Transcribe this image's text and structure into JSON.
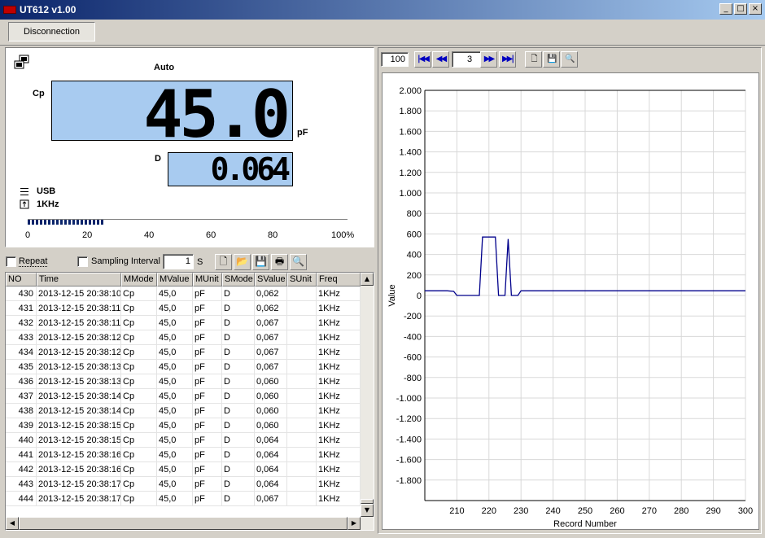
{
  "window": {
    "title": "UT612 v1.00",
    "btn_min": "_",
    "btn_max": "□",
    "btn_close": "×"
  },
  "toolbar": {
    "disconnect_label": "Disconnection"
  },
  "meter": {
    "mode": "Auto",
    "primary_label": "Cp",
    "primary_value": "45.0",
    "primary_unit": "pF",
    "secondary_label": "D",
    "secondary_value": "0.064",
    "interface": "USB",
    "frequency": "1KHz",
    "progress_percent": 24,
    "scale": [
      "0",
      "20",
      "40",
      "60",
      "80",
      "100%"
    ]
  },
  "table_toolbar": {
    "repeat_label": "Repeat",
    "sampling_label": "Sampling Interval",
    "sampling_value": "1",
    "sampling_unit": "S"
  },
  "table": {
    "columns": [
      "NO",
      "Time",
      "MMode",
      "MValue",
      "MUnit",
      "SMode",
      "SValue",
      "SUnit",
      "Freq"
    ],
    "rows": [
      [
        "430",
        "2013-12-15 20:38:10",
        "Cp",
        "45,0",
        "pF",
        "D",
        "0,062",
        "",
        "1KHz"
      ],
      [
        "431",
        "2013-12-15 20:38:11",
        "Cp",
        "45,0",
        "pF",
        "D",
        "0,062",
        "",
        "1KHz"
      ],
      [
        "432",
        "2013-12-15 20:38:11",
        "Cp",
        "45,0",
        "pF",
        "D",
        "0,067",
        "",
        "1KHz"
      ],
      [
        "433",
        "2013-12-15 20:38:12",
        "Cp",
        "45,0",
        "pF",
        "D",
        "0,067",
        "",
        "1KHz"
      ],
      [
        "434",
        "2013-12-15 20:38:12",
        "Cp",
        "45,0",
        "pF",
        "D",
        "0,067",
        "",
        "1KHz"
      ],
      [
        "435",
        "2013-12-15 20:38:13",
        "Cp",
        "45,0",
        "pF",
        "D",
        "0,067",
        "",
        "1KHz"
      ],
      [
        "436",
        "2013-12-15 20:38:13",
        "Cp",
        "45,0",
        "pF",
        "D",
        "0,060",
        "",
        "1KHz"
      ],
      [
        "437",
        "2013-12-15 20:38:14",
        "Cp",
        "45,0",
        "pF",
        "D",
        "0,060",
        "",
        "1KHz"
      ],
      [
        "438",
        "2013-12-15 20:38:14",
        "Cp",
        "45,0",
        "pF",
        "D",
        "0,060",
        "",
        "1KHz"
      ],
      [
        "439",
        "2013-12-15 20:38:15",
        "Cp",
        "45,0",
        "pF",
        "D",
        "0,060",
        "",
        "1KHz"
      ],
      [
        "440",
        "2013-12-15 20:38:15",
        "Cp",
        "45,0",
        "pF",
        "D",
        "0,064",
        "",
        "1KHz"
      ],
      [
        "441",
        "2013-12-15 20:38:16",
        "Cp",
        "45,0",
        "pF",
        "D",
        "0,064",
        "",
        "1KHz"
      ],
      [
        "442",
        "2013-12-15 20:38:16",
        "Cp",
        "45,0",
        "pF",
        "D",
        "0,064",
        "",
        "1KHz"
      ],
      [
        "443",
        "2013-12-15 20:38:17",
        "Cp",
        "45,0",
        "pF",
        "D",
        "0,064",
        "",
        "1KHz"
      ],
      [
        "444",
        "2013-12-15 20:38:17",
        "Cp",
        "45,0",
        "pF",
        "D",
        "0,067",
        "",
        "1KHz"
      ]
    ]
  },
  "chart_nav": {
    "zoom_value": "100",
    "page_value": "3"
  },
  "chart_data": {
    "type": "line",
    "xlabel": "Record Number",
    "ylabel": "Value",
    "xlim": [
      200,
      300
    ],
    "ylim": [
      -2000,
      2000
    ],
    "x_ticks": [
      210,
      220,
      230,
      240,
      250,
      260,
      270,
      280,
      290,
      300
    ],
    "y_ticks": [
      "2.000",
      "1.800",
      "1.600",
      "1.400",
      "1.200",
      "1.000",
      "800",
      "600",
      "400",
      "200",
      "0",
      "-200",
      "-400",
      "-600",
      "-800",
      "-1.000",
      "-1.200",
      "-1.400",
      "-1.600",
      "-1.800"
    ],
    "grid": true,
    "line_color": "#00008b",
    "x": [
      200,
      207,
      209,
      210,
      217,
      218,
      219,
      222,
      223,
      225,
      226,
      227,
      228,
      229,
      230,
      300
    ],
    "y": [
      45,
      45,
      40,
      0,
      0,
      570,
      570,
      570,
      0,
      0,
      550,
      0,
      0,
      0,
      45,
      45
    ]
  }
}
